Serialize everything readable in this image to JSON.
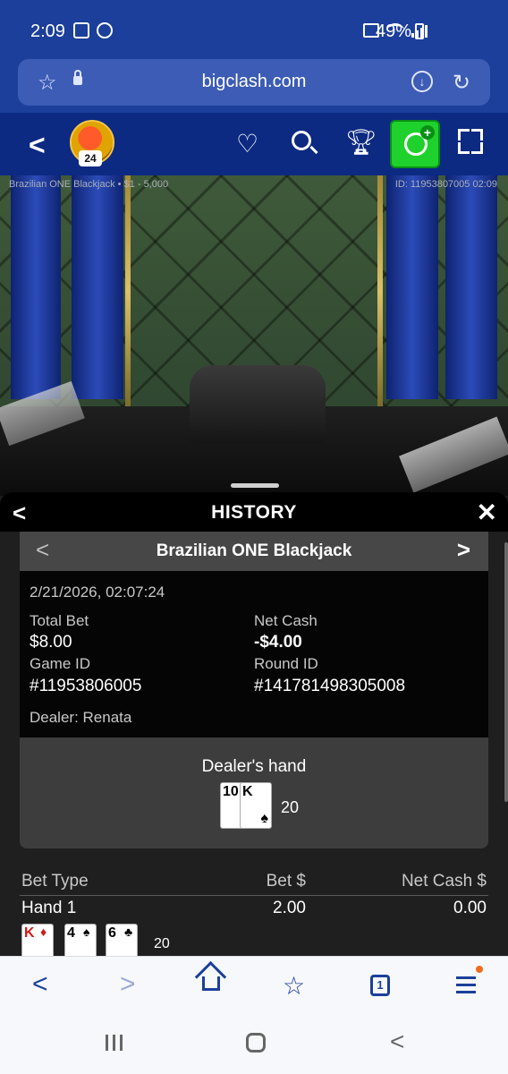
{
  "status_bar": {
    "time": "2:09",
    "battery": "49%"
  },
  "browser": {
    "url": "bigclash.com",
    "tab_count": "1"
  },
  "game_header": {
    "level": "24"
  },
  "video": {
    "table_label": "Brazilian ONE Blackjack • $1 - 5,000",
    "id_label": "ID: 11953807005 02:09"
  },
  "history": {
    "title": "HISTORY",
    "game_name": "Brazilian ONE Blackjack",
    "datetime": "2/21/2026, 02:07:24",
    "total_bet_label": "Total Bet",
    "total_bet": "$8.00",
    "net_cash_label": "Net Cash",
    "net_cash": "-$4.00",
    "game_id_label": "Game ID",
    "game_id": "#11953806005",
    "round_id_label": "Round ID",
    "round_id": "#141781498305008",
    "dealer": "Dealer: Renata",
    "dealer_hand_title": "Dealer's hand",
    "dealer_cards": [
      {
        "rank": "10",
        "suit": "♣",
        "color": "#000000"
      },
      {
        "rank": "K",
        "suit": "♠",
        "color": "#000000"
      }
    ],
    "dealer_total": "20",
    "bet_table": {
      "headers": [
        "Bet Type",
        "Bet $",
        "Net Cash $"
      ],
      "rows": [
        {
          "type": "Hand 1",
          "bet": "2.00",
          "net": "0.00"
        }
      ]
    },
    "hand1_cards": [
      {
        "rank": "K",
        "suit": "♦",
        "color": "#d01818"
      },
      {
        "rank": "4",
        "suit": "♠",
        "color": "#000000"
      },
      {
        "rank": "6",
        "suit": "♣",
        "color": "#000000"
      }
    ],
    "hand1_total": "20"
  },
  "colors": {
    "brand_blue": "#1b3f9a",
    "cashier_green": "#1fd12d"
  }
}
